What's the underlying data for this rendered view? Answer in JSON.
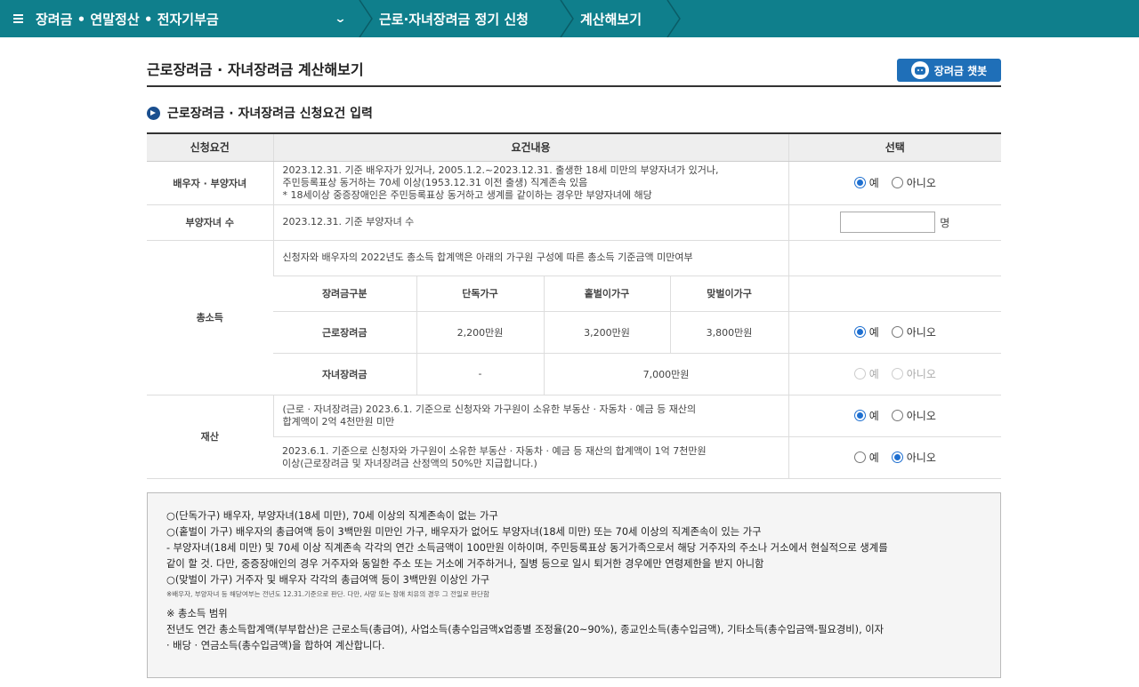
{
  "nav": {
    "menu_title": "장려금 • 연말정산 • 전자기부금",
    "crumb2": "근로·자녀장려금 정기 신청",
    "crumb3": "계산해보기"
  },
  "page": {
    "title": "근로장려금 · 자녀장려금 계산해보기",
    "chatbot_label": "장려금 챗봇",
    "section_title": "근로장려금 · 자녀장려금 신청요건 입력"
  },
  "table": {
    "headers": [
      "신청요건",
      "요건내용",
      "선택"
    ],
    "spouse": {
      "label": "배우자 · 부양자녀",
      "desc1": "2023.12.31. 기준 배우자가 있거나, 2005.1.2.~2023.12.31. 출생한 18세 미만의 부양자녀가 있거나,",
      "desc2": "주민등록표상 동거하는 70세 이상(1953.12.31 이전 출생) 직계존속 있음",
      "desc3": "* 18세이상 중증장애인은 주민등록표상 동거하고 생계를 같이하는 경우만 부양자녀에 해당"
    },
    "children": {
      "label": "부양자녀 수",
      "desc": "2023.12.31. 기준 부양자녀 수",
      "unit": "명"
    },
    "income": {
      "label": "총소득",
      "desc": "신청자와 배우자의 2022년도 총소득 합계액은 아래의 가구원 구성에 따른 총소득 기준금액 미만여부",
      "sub_headers": [
        "장려금구분",
        "단독가구",
        "홑벌이가구",
        "맞벌이가구"
      ],
      "row1": [
        "근로장려금",
        "2,200만원",
        "3,200만원",
        "3,800만원"
      ],
      "row2": [
        "자녀장려금",
        "-",
        "7,000만원"
      ]
    },
    "assets": {
      "label": "재산",
      "desc1a": "(근로 · 자녀장려금) 2023.6.1. 기준으로 신청자와 가구원이 소유한 부동산 · 자동차 · 예금 등 재산의",
      "desc1b": "합계액이 2억 4천만원 미만",
      "desc2a": "2023.6.1. 기준으로 신청자와 가구원이 소유한 부동산 · 자동차 · 예금 등 재산의 합계액이 1억 7천만원",
      "desc2b": "이상(근로장려금 및 자녀장려금 산정액의 50%만 지급합니다.)"
    },
    "yes": "예",
    "no": "아니오"
  },
  "notice": {
    "l1": "○(단독가구) 배우자, 부양자녀(18세 미만), 70세 이상의 직계존속이 없는 가구",
    "l2": "○(홑벌이 가구) 배우자의 총급여액 등이 3백만원 미만인 가구, 배우자가 없어도 부양자녀(18세 미만) 또는 70세 이상의 직계존속이 있는 가구",
    "l3": "- 부양자녀(18세 미만) 및 70세 이상 직계존속 각각의 연간 소득금액이 100만원 이하이며, 주민등록표상 동거가족으로서 해당 거주자의 주소나 거소에서 현실적으로 생계를",
    "l4": "같이 할 것. 다만, 중증장애인의 경우 거주자와 동일한 주소 또는 거소에 거주하거나, 질병 등으로 일시 퇴거한 경우에만 연령제한을 받지 아니함",
    "l5": "○(맞벌이 가구) 거주자 및 배우자 각각의 총급여액 등이 3백만원 이상인 가구",
    "small": "※배우자, 부양자녀 등 해당여부는 전년도 12.31.기준으로 판단. 다만, 사망 또는 장애 치유의 경우 그 전일로 판단함",
    "range_title": "※ 총소득 범위",
    "r1": "전년도 연간 총소득합계액(부부합산)은 근로소득(총급여), 사업소득(총수입금액x업종별 조정율(20~90%), 종교인소득(총수입금액), 기타소득(총수입금액-필요경비), 이자",
    "r2": " · 배당 · 연금소득(총수입금액)을 합하여 계산합니다."
  }
}
